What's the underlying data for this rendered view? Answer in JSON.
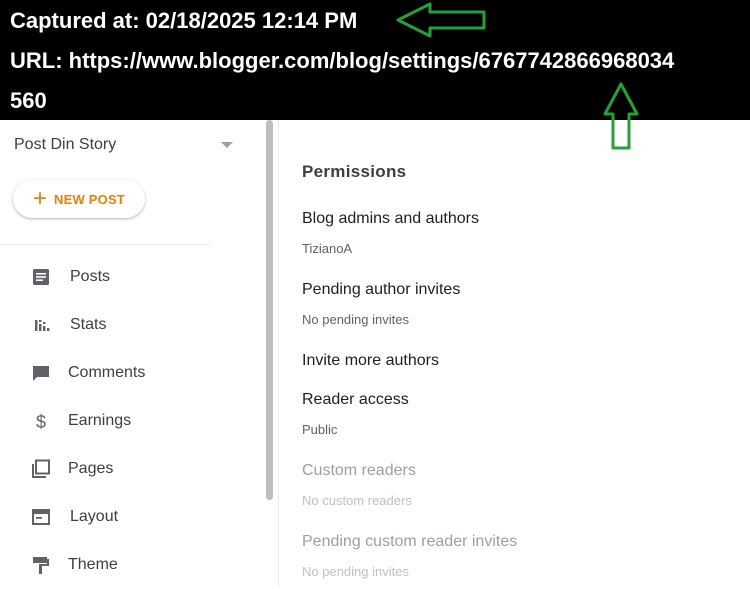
{
  "capture": {
    "captured_at": "Captured at: 02/18/2025 12:14 PM",
    "url_line1": "URL: https://www.blogger.com/blog/settings/6767742866968034",
    "url_line2": "560"
  },
  "sidebar": {
    "blog_name": "Post Din Story",
    "new_post": "NEW POST",
    "items": [
      {
        "label": "Posts",
        "icon": "posts-icon"
      },
      {
        "label": "Stats",
        "icon": "stats-icon"
      },
      {
        "label": "Comments",
        "icon": "comments-icon"
      },
      {
        "label": "Earnings",
        "icon": "earnings-icon"
      },
      {
        "label": "Pages",
        "icon": "pages-icon"
      },
      {
        "label": "Layout",
        "icon": "layout-icon"
      },
      {
        "label": "Theme",
        "icon": "theme-icon"
      }
    ]
  },
  "main": {
    "title": "Permissions",
    "rows": [
      {
        "label": "Blog admins and authors",
        "value": "TizianoA"
      },
      {
        "label": "Pending author invites",
        "value": "No pending invites"
      },
      {
        "label": "Invite more authors",
        "value": ""
      },
      {
        "label": "Reader access",
        "value": "Public"
      },
      {
        "label": "Custom readers",
        "value": "No custom readers"
      },
      {
        "label": "Pending custom reader invites",
        "value": "No pending invites"
      }
    ]
  },
  "colors": {
    "accent": "#f57c00",
    "annotation": "#21a336"
  }
}
